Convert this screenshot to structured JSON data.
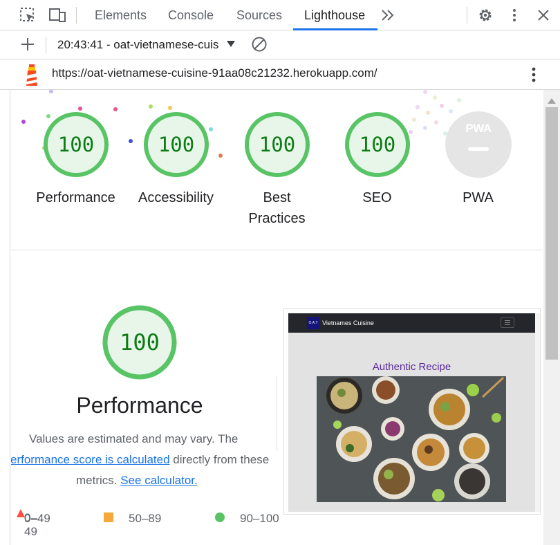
{
  "devtools": {
    "tabs": [
      {
        "label": "Elements"
      },
      {
        "label": "Console"
      },
      {
        "label": "Sources"
      },
      {
        "label": "Lighthouse"
      }
    ],
    "report_selector": "20:43:41 - oat-vietnamese-cuis",
    "url": "https://oat-vietnamese-cuisine-91aa08c21232.herokuapp.com/"
  },
  "categories": [
    {
      "label": "Performance",
      "score": "100"
    },
    {
      "label": "Accessibility",
      "score": "100"
    },
    {
      "label_line1": "Best",
      "label_line2": "Practices",
      "score": "100"
    },
    {
      "label": "SEO",
      "score": "100"
    },
    {
      "label": "PWA",
      "badge": "PWA"
    }
  ],
  "performance": {
    "score": "100",
    "title": "Performance",
    "desc_line1": "Values are estimated and may vary. The",
    "desc_link1": "erformance score is calculated",
    "desc_line2_rest": " directly from these",
    "desc_line3_pre": "metrics. ",
    "desc_link2": "See calculator.",
    "legend": [
      {
        "label": "0–49"
      },
      {
        "label": "50–89"
      },
      {
        "label": "90–100"
      }
    ]
  },
  "screenshot": {
    "logo_text": "O.A.T",
    "site_name": "Vietnames Cuisine",
    "heading": "Authentic Recipe"
  },
  "colors": {
    "pass": "#0c7c14",
    "pass_ring": "#0cce6b",
    "average": "#ffa400",
    "accent": "#1a73e8"
  }
}
